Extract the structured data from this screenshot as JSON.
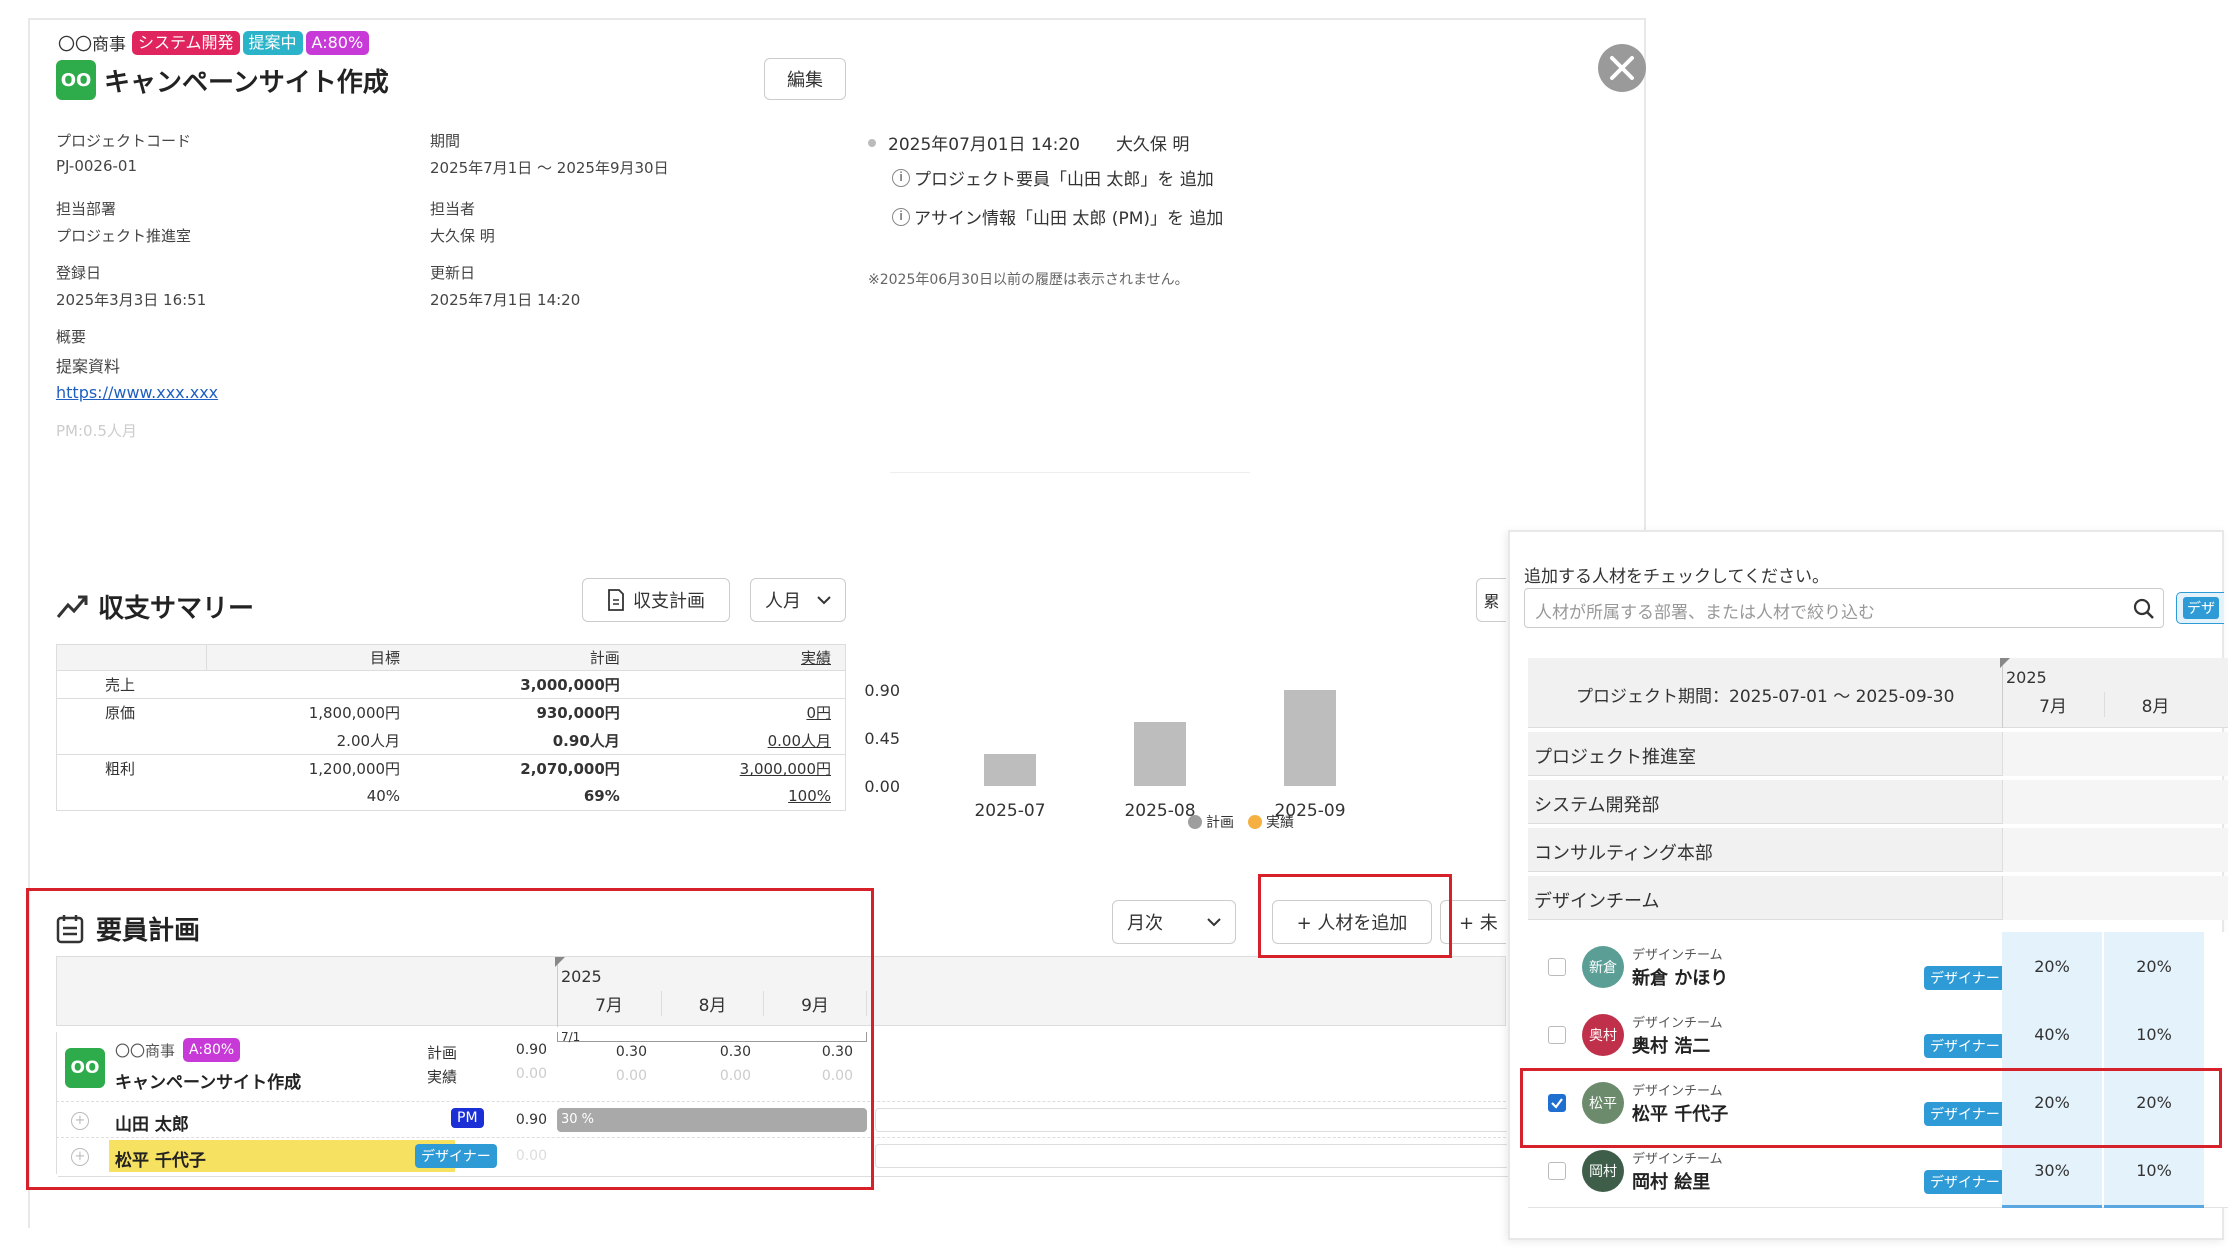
{
  "header": {
    "client": "〇〇商事",
    "tags": [
      {
        "label": "システム開発",
        "color": "#e0245e"
      },
      {
        "label": "提案中",
        "color": "#2bb3c9"
      },
      {
        "label": "A:80%",
        "color": "#c83ad8"
      }
    ],
    "logo_text": "OO",
    "title": "キャンペーンサイト作成",
    "edit_label": "編集"
  },
  "info": {
    "project_code_label": "プロジェクトコード",
    "project_code": "PJ-0026-01",
    "dept_label": "担当部署",
    "dept": "プロジェクト推進室",
    "registered_label": "登録日",
    "registered": "2025年3月3日 16:51",
    "summary_label": "概要",
    "summary": "提案資料",
    "link": "https://www.xxx.xxx",
    "pm_note": "PM:0.5人月",
    "period_label": "期間",
    "period": "2025年7月1日 ～ 2025年9月30日",
    "owner_label": "担当者",
    "owner": "大久保 明",
    "updated_label": "更新日",
    "updated": "2025年7月1日 14:20"
  },
  "history": {
    "timestamp": "2025年07月01日 14:20",
    "user": "大久保 明",
    "items": [
      "プロジェクト要員「山田 太郎」を 追加",
      "アサイン情報「山田 太郎 (PM)」を 追加"
    ],
    "note": "※2025年06月30日以前の履歴は表示されません。"
  },
  "summary": {
    "title": "収支サマリー",
    "plan_button": "収支計画",
    "unit_select": "人月",
    "cut_button": "累",
    "headers": [
      "",
      "目標",
      "計画",
      "実績"
    ],
    "rows": [
      {
        "label": "売上",
        "target": "",
        "plan": "3,000,000円",
        "actual": ""
      },
      {
        "label": "原価",
        "target": "1,800,000円",
        "plan": "930,000円",
        "actual": "0円"
      },
      {
        "label": "",
        "target": "2.00人月",
        "plan": "0.90人月",
        "actual": "0.00人月"
      },
      {
        "label": "粗利",
        "target": "1,200,000円",
        "plan": "2,070,000円",
        "actual": "3,000,000円"
      },
      {
        "label": "",
        "target": "40%",
        "plan": "69%",
        "actual": "100%"
      }
    ]
  },
  "chart_data": {
    "type": "bar",
    "categories": [
      "2025-07",
      "2025-08",
      "2025-09"
    ],
    "series": [
      {
        "name": "計画",
        "values": [
          0.3,
          0.6,
          0.9
        ],
        "color": "#bdbdbd"
      },
      {
        "name": "実績",
        "values": [
          0,
          0,
          0
        ],
        "color": "#f5b041"
      }
    ],
    "y_ticks": [
      "0.90",
      "0.45",
      "0.00"
    ],
    "ylim": [
      0,
      0.9
    ],
    "legend": "bottom"
  },
  "staffing": {
    "title": "要員計画",
    "period_select": "月次",
    "add_button": "+ 人材を追加",
    "cut_button": "+ 未",
    "year": "2025",
    "months": [
      "7月",
      "8月",
      "9月"
    ],
    "marker": "7/1",
    "project_row": {
      "client": "〇〇商事",
      "tag": "A:80%",
      "name": "キャンペーンサイト作成",
      "plan_label": "計画",
      "actual_label": "実績",
      "plan_total": "0.90",
      "actual_total": "0.00",
      "plan_values": [
        "0.30",
        "0.30",
        "0.30"
      ],
      "actual_values": [
        "0.00",
        "0.00",
        "0.00"
      ]
    },
    "members": [
      {
        "name": "山田 太郎",
        "role": "PM",
        "total": "0.90",
        "bar_label": "30 %"
      },
      {
        "name": "松平 千代子",
        "role": "デザイナー",
        "total": "0.00",
        "bar_label": ""
      }
    ]
  },
  "picker": {
    "instruction": "追加する人材をチェックしてください。",
    "search_placeholder": "人材が所属する部署、または人材で絞り込む",
    "filter_chip": "デザ",
    "period_label": "プロジェクト期間：2025-07-01 〜 2025-09-30",
    "year": "2025",
    "months": [
      "7月",
      "8月"
    ],
    "departments": [
      "プロジェクト推進室",
      "システム開発部",
      "コンサルティング本部",
      "デザインチーム"
    ],
    "people": [
      {
        "avatar": "新倉",
        "avatar_color": "#5a9e96",
        "team": "デザインチーム",
        "name": "新倉 かほり",
        "role": "デザイナー",
        "m7": "20%",
        "m8": "20%",
        "checked": false
      },
      {
        "avatar": "奥村",
        "avatar_color": "#c0304a",
        "team": "デザインチーム",
        "name": "奥村 浩二",
        "role": "デザイナー",
        "m7": "40%",
        "m8": "10%",
        "checked": false
      },
      {
        "avatar": "松平",
        "avatar_color": "#6c8a6c",
        "team": "デザインチーム",
        "name": "松平 千代子",
        "role": "デザイナー",
        "m7": "20%",
        "m8": "20%",
        "checked": true
      },
      {
        "avatar": "岡村",
        "avatar_color": "#3f5e4a",
        "team": "デザインチーム",
        "name": "岡村 絵里",
        "role": "デザイナー",
        "m7": "30%",
        "m8": "10%",
        "checked": false
      }
    ]
  }
}
